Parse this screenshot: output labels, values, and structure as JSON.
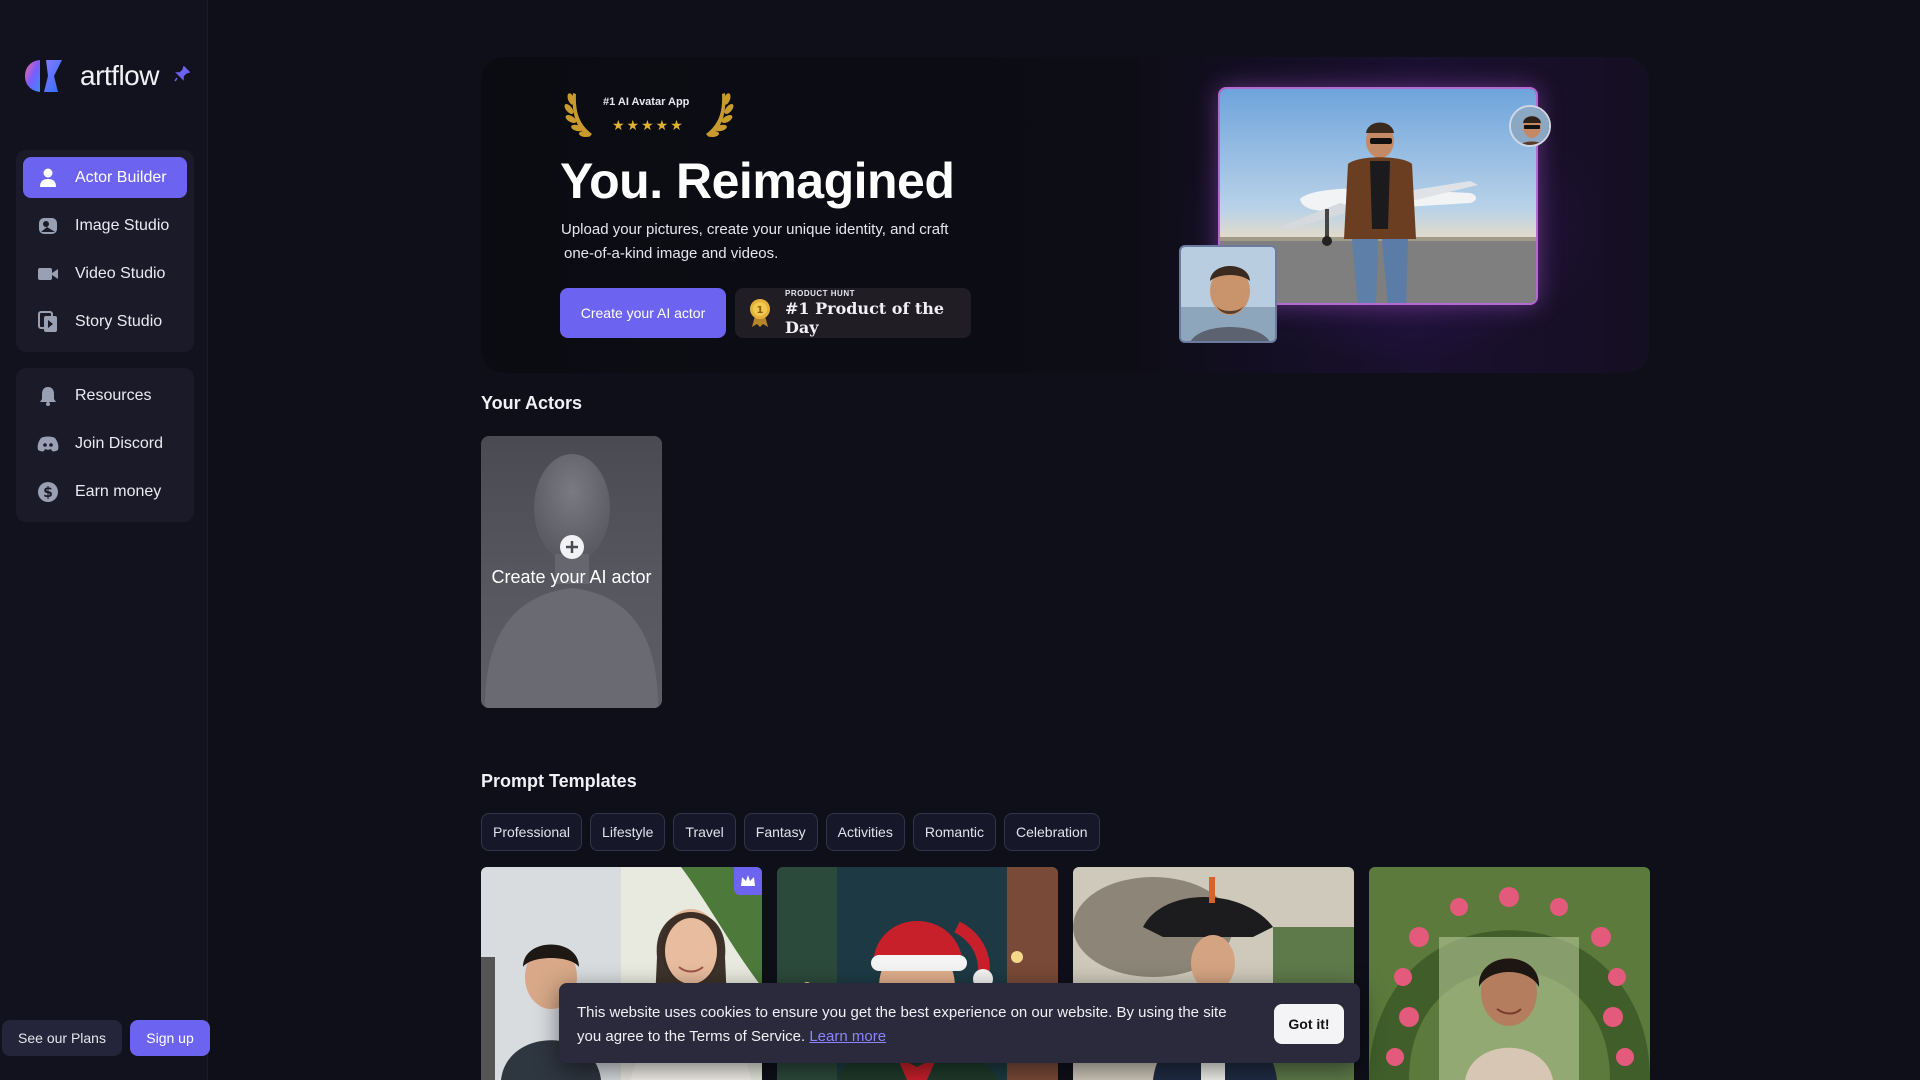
{
  "brand": {
    "name": "artflow"
  },
  "sidebar": {
    "primary": [
      {
        "label": "Actor Builder",
        "icon": "user-icon",
        "active": true
      },
      {
        "label": "Image Studio",
        "icon": "image-icon"
      },
      {
        "label": "Video Studio",
        "icon": "video-icon"
      },
      {
        "label": "Story Studio",
        "icon": "story-icon"
      }
    ],
    "secondary": [
      {
        "label": "Resources",
        "icon": "bell-icon"
      },
      {
        "label": "Join Discord",
        "icon": "discord-icon"
      },
      {
        "label": "Earn money",
        "icon": "dollar-icon"
      }
    ],
    "see_plans": "See our Plans",
    "sign_up": "Sign up"
  },
  "hero": {
    "award": "#1 AI Avatar App",
    "stars": "★★★★★",
    "title": "You. Reimagined",
    "description_line1": "Upload your pictures, create your unique identity, and craft",
    "description_line2": "one-of-a-kind image and videos.",
    "cta": "Create your AI actor",
    "product_hunt_small": "PRODUCT HUNT",
    "product_hunt_big": "#1 Product of the Day"
  },
  "actors": {
    "title": "Your Actors",
    "create_label": "Create your AI actor"
  },
  "templates": {
    "title": "Prompt Templates",
    "categories": [
      "Professional",
      "Lifestyle",
      "Travel",
      "Fantasy",
      "Activities",
      "Romantic",
      "Celebration"
    ]
  },
  "cookie": {
    "text": "This website uses cookies to ensure you get the best experience on our website. By using the site you agree to the Terms of Service.",
    "link": "Learn more",
    "button": "Got it!"
  },
  "colors": {
    "accent": "#6c63f0",
    "background": "#0f0f1a",
    "sidebar": "#12121f"
  }
}
